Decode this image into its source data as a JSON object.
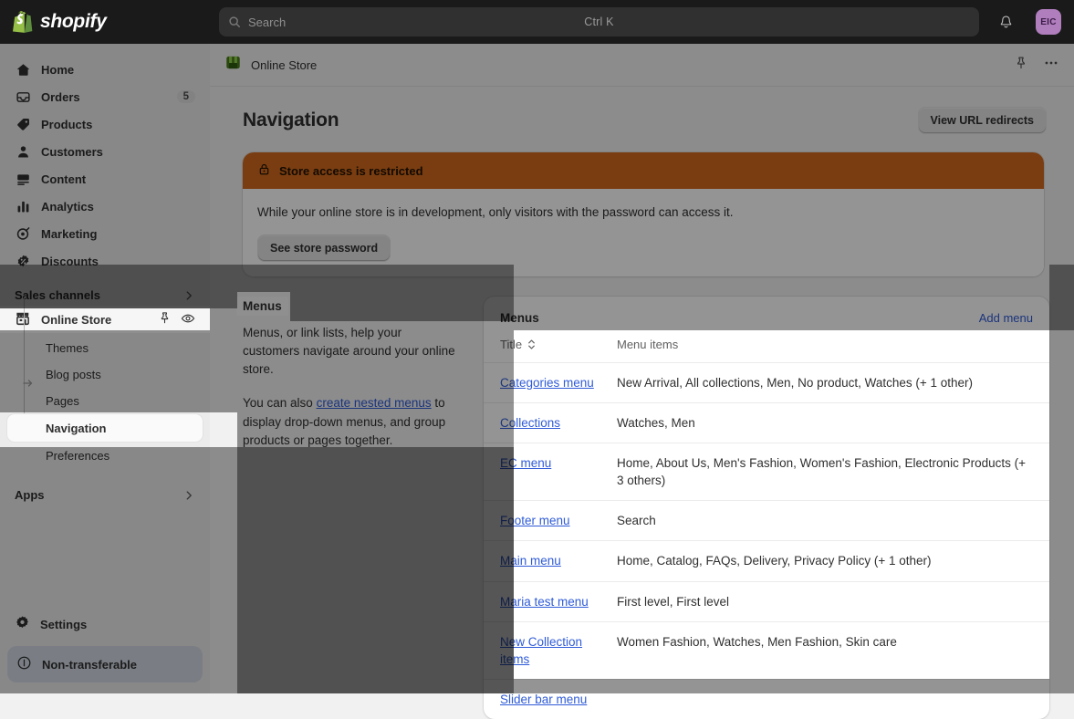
{
  "topbar": {
    "brand": "shopify",
    "search": {
      "placeholder": "Search",
      "value": "",
      "shortcut": "Ctrl K"
    },
    "notifications_icon": "bell-icon",
    "avatar_initials": "EIC"
  },
  "sidebar": {
    "items": [
      {
        "label": "Home",
        "icon": "home-icon",
        "badge": ""
      },
      {
        "label": "Orders",
        "icon": "orders-icon",
        "badge": "5"
      },
      {
        "label": "Products",
        "icon": "products-tag-icon",
        "badge": ""
      },
      {
        "label": "Customers",
        "icon": "customers-person-icon",
        "badge": ""
      },
      {
        "label": "Content",
        "icon": "content-icon",
        "badge": ""
      },
      {
        "label": "Analytics",
        "icon": "analytics-bars-icon",
        "badge": ""
      },
      {
        "label": "Marketing",
        "icon": "marketing-target-icon",
        "badge": ""
      },
      {
        "label": "Discounts",
        "icon": "discounts-badge-icon",
        "badge": ""
      }
    ],
    "sales_channels_label": "Sales channels",
    "online_store": {
      "label": "Online Store",
      "icon": "storefront-icon",
      "pin_icon": "pin-icon",
      "view_icon": "eye-icon"
    },
    "online_store_children": [
      {
        "label": "Themes",
        "active": false
      },
      {
        "label": "Blog posts",
        "active": false
      },
      {
        "label": "Pages",
        "active": false
      },
      {
        "label": "Navigation",
        "active": true
      },
      {
        "label": "Preferences",
        "active": false
      }
    ],
    "apps_label": "Apps",
    "settings_label": "Settings",
    "settings_icon": "gear-icon",
    "plan_badge": {
      "label": "Non-transferable",
      "icon": "info-circle-icon"
    }
  },
  "context_bar": {
    "store_icon": "online-store-green-icon",
    "title": "Online Store",
    "pin_icon": "pin-icon",
    "more_icon": "ellipsis-horizontal-icon"
  },
  "page": {
    "title": "Navigation",
    "primary_action": "View URL redirects"
  },
  "banner": {
    "icon": "lock-icon",
    "heading": "Store access is restricted",
    "body": "While your online store is in development, only visitors with the password can access it.",
    "action": "See store password",
    "color": "#d2691e"
  },
  "menus_info": {
    "heading": "Menus",
    "paragraph_1": "Menus, or link lists, help your customers navigate around your online store.",
    "paragraph_2_before": "You can also ",
    "paragraph_2_link": "create nested menus",
    "paragraph_2_after": " to display drop-down menus, and group products or pages together."
  },
  "menus_card": {
    "title": "Menus",
    "add_action": "Add menu",
    "columns": {
      "title": "Title",
      "items": "Menu items"
    },
    "sort_icon": "sort-chevrons-icon",
    "rows": [
      {
        "title": "Categories menu",
        "items": "New Arrival, All collections, Men, No product, Watches (+ 1 other)"
      },
      {
        "title": "Collections",
        "items": "Watches, Men"
      },
      {
        "title": "EC menu",
        "items": "Home, About Us, Men's Fashion, Women's Fashion, Electronic Products (+ 3 others)"
      },
      {
        "title": "Footer menu",
        "items": "Search"
      },
      {
        "title": "Main menu",
        "items": "Home, Catalog, FAQs, Delivery, Privacy Policy (+ 1 other)"
      },
      {
        "title": "Maria test menu",
        "items": "First level, First level"
      },
      {
        "title": "New Collection items",
        "items": "Women Fashion, Watches, Men Fashion, Skin care"
      },
      {
        "title": "Slider bar menu",
        "items": ""
      }
    ]
  },
  "colors": {
    "accent_link": "#2f5bd7",
    "banner_orange": "#d2691e",
    "avatar_purple": "#b07dbd",
    "topbar_dark": "#1a1a1a"
  }
}
